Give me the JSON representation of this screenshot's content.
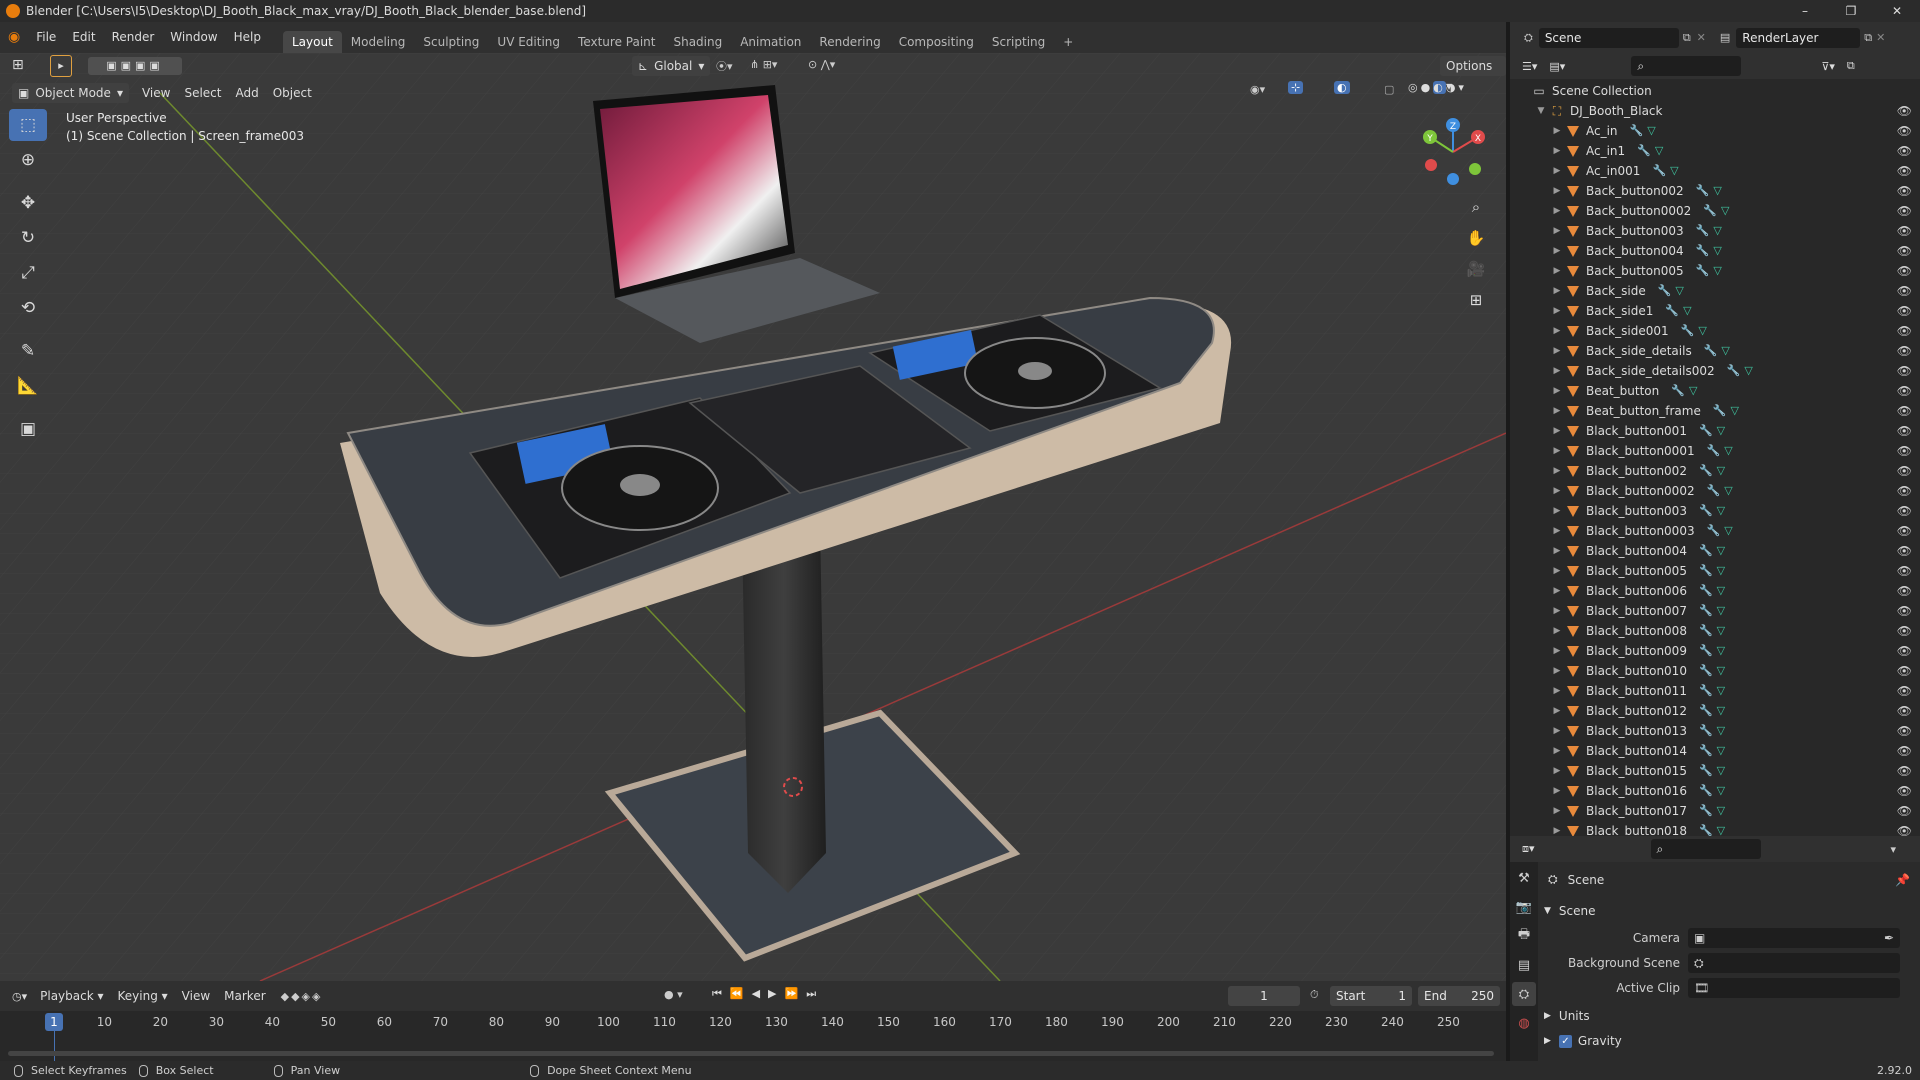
{
  "window": {
    "title": "Blender [C:\\Users\\I5\\Desktop\\DJ_Booth_Black_max_vray/DJ_Booth_Black_blender_base.blend]",
    "controls": [
      "–",
      "❐",
      "✕"
    ]
  },
  "menubar": {
    "menus": [
      "File",
      "Edit",
      "Render",
      "Window",
      "Help"
    ],
    "workspaces": [
      "Layout",
      "Modeling",
      "Sculpting",
      "UV Editing",
      "Texture Paint",
      "Shading",
      "Animation",
      "Rendering",
      "Compositing",
      "Scripting"
    ],
    "active_workspace": "Layout",
    "add_tab": "+"
  },
  "scene_selector": {
    "scene": "Scene",
    "view_layer": "RenderLayer"
  },
  "viewport": {
    "transform_orientation": "Global",
    "options_label": "Options",
    "mode": "Object Mode",
    "menus": [
      "View",
      "Select",
      "Add",
      "Object"
    ],
    "info_line1": "User Perspective",
    "info_line2": "(1) Scene Collection | Screen_frame003",
    "gizmo": {
      "x": "X",
      "y": "Y",
      "z": "Z"
    }
  },
  "timeline": {
    "menus": [
      "Playback",
      "Keying",
      "View",
      "Marker"
    ],
    "current_frame": "1",
    "start_label": "Start",
    "start": "1",
    "end_label": "End",
    "end": "250",
    "ticks": [
      "10",
      "20",
      "30",
      "40",
      "50",
      "60",
      "70",
      "80",
      "90",
      "100",
      "110",
      "120",
      "130",
      "140",
      "150",
      "160",
      "170",
      "180",
      "190",
      "200",
      "210",
      "220",
      "230",
      "240",
      "250"
    ],
    "cursor_frame": "1"
  },
  "outliner": {
    "root": "Scene Collection",
    "collection": "DJ_Booth_Black",
    "objects": [
      "Ac_in",
      "Ac_in1",
      "Ac_in001",
      "Back_button002",
      "Back_button0002",
      "Back_button003",
      "Back_button004",
      "Back_button005",
      "Back_side",
      "Back_side1",
      "Back_side001",
      "Back_side_details",
      "Back_side_details002",
      "Beat_button",
      "Beat_button_frame",
      "Black_button001",
      "Black_button0001",
      "Black_button002",
      "Black_button0002",
      "Black_button003",
      "Black_button0003",
      "Black_button004",
      "Black_button005",
      "Black_button006",
      "Black_button007",
      "Black_button008",
      "Black_button009",
      "Black_button010",
      "Black_button011",
      "Black_button012",
      "Black_button013",
      "Black_button014",
      "Black_button015",
      "Black_button016",
      "Black_button017",
      "Black_button018"
    ]
  },
  "properties": {
    "context": "Scene",
    "panel": "Scene",
    "camera_label": "Camera",
    "background_scene_label": "Background Scene",
    "active_clip_label": "Active Clip",
    "units_label": "Units",
    "gravity_label": "Gravity",
    "gravity_checked": true
  },
  "statusbar": {
    "items": [
      "Select Keyframes",
      "Box Select",
      "Pan View",
      "Dope Sheet Context Menu"
    ],
    "version": "2.92.0"
  },
  "colors": {
    "accent": "#4772b3",
    "object_icon": "#e88a3c",
    "mesh_icon": "#3fc4a0",
    "axis_x": "#e04b4b",
    "axis_y": "#7ec53a",
    "axis_z": "#3f8fe0"
  }
}
